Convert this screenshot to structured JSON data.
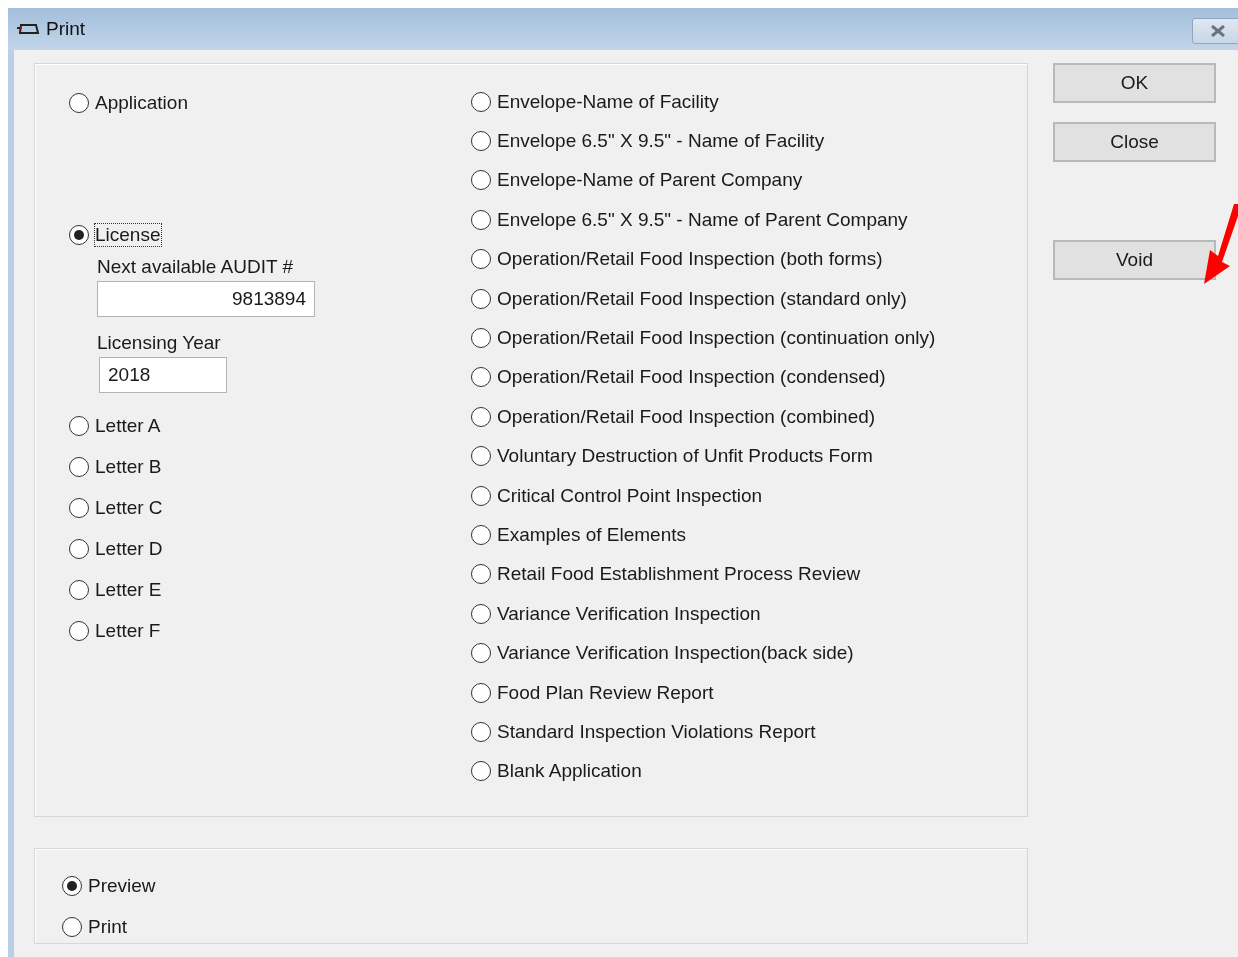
{
  "window": {
    "title": "Print"
  },
  "left_options": [
    {
      "label": "Application",
      "selected": false
    },
    {
      "label": "License",
      "selected": true,
      "fields": [
        {
          "label": "Next available AUDIT #",
          "value": "9813894"
        },
        {
          "label": "Licensing Year",
          "value": "2018"
        }
      ]
    },
    {
      "label": "Letter A",
      "selected": false
    },
    {
      "label": "Letter B",
      "selected": false
    },
    {
      "label": "Letter C",
      "selected": false
    },
    {
      "label": "Letter D",
      "selected": false
    },
    {
      "label": "Letter E",
      "selected": false
    },
    {
      "label": "Letter F",
      "selected": false
    }
  ],
  "right_options": [
    {
      "label": "Envelope-Name of Facility",
      "selected": false
    },
    {
      "label": "Envelope 6.5\" X 9.5\" - Name of Facility",
      "selected": false
    },
    {
      "label": "Envelope-Name of Parent Company",
      "selected": false
    },
    {
      "label": "Envelope 6.5\" X 9.5\" - Name of Parent Company",
      "selected": false
    },
    {
      "label": "Operation/Retail Food Inspection (both forms)",
      "selected": false
    },
    {
      "label": "Operation/Retail Food Inspection (standard only)",
      "selected": false
    },
    {
      "label": "Operation/Retail Food Inspection (continuation only)",
      "selected": false
    },
    {
      "label": "Operation/Retail Food Inspection (condensed)",
      "selected": false
    },
    {
      "label": "Operation/Retail Food Inspection (combined)",
      "selected": false
    },
    {
      "label": "Voluntary Destruction of Unfit Products Form",
      "selected": false
    },
    {
      "label": "Critical Control Point Inspection",
      "selected": false
    },
    {
      "label": "Examples of Elements",
      "selected": false
    },
    {
      "label": "Retail Food Establishment Process Review",
      "selected": false
    },
    {
      "label": "Variance Verification Inspection",
      "selected": false
    },
    {
      "label": "Variance Verification Inspection(back side)",
      "selected": false
    },
    {
      "label": "Food Plan Review Report",
      "selected": false
    },
    {
      "label": "Standard Inspection Violations Report",
      "selected": false
    },
    {
      "label": "Blank Application",
      "selected": false
    }
  ],
  "output_options": [
    {
      "label": "Preview",
      "selected": true
    },
    {
      "label": "Print",
      "selected": false
    }
  ],
  "buttons": [
    {
      "label": "OK"
    },
    {
      "label": "Close"
    },
    {
      "label": "Void"
    }
  ]
}
